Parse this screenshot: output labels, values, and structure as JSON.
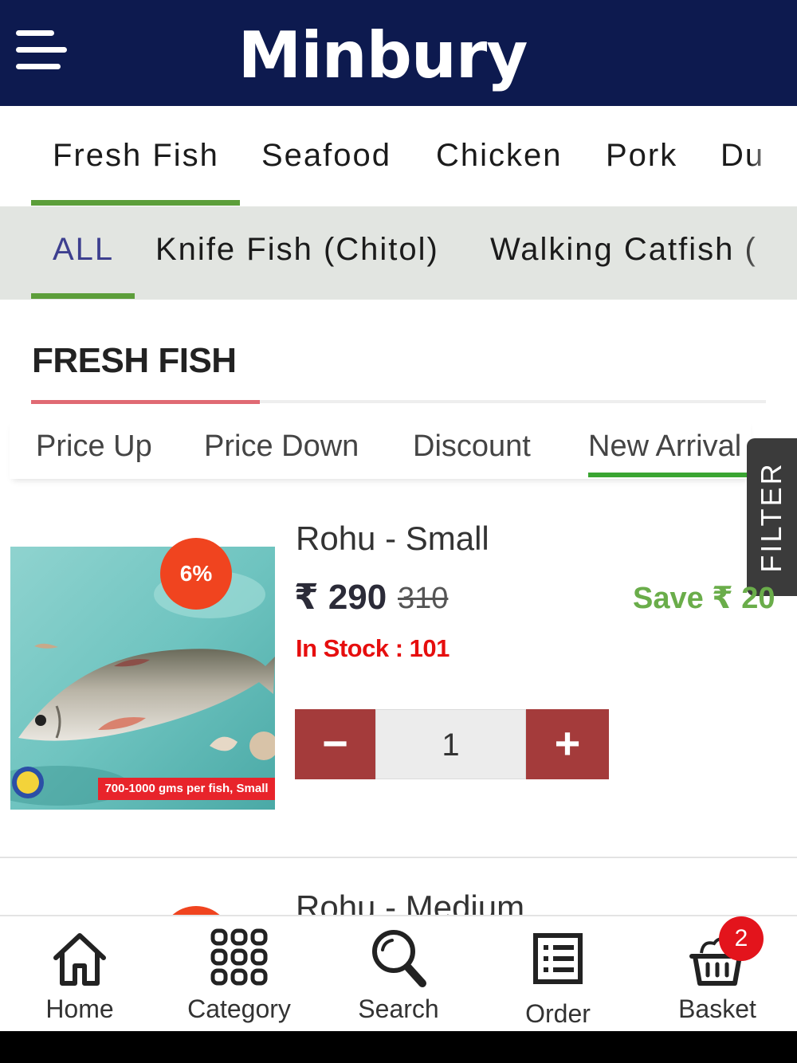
{
  "header": {
    "brand": "Minbury",
    "menu_icon": "hamburger-menu-icon"
  },
  "category_tabs": [
    "Fresh Fish",
    "Seafood",
    "Chicken",
    "Pork",
    "Du"
  ],
  "sub_tabs": [
    "ALL",
    "Knife Fish (Chitol)",
    "Walking Catfish ("
  ],
  "section": {
    "title": "FRESH FISH"
  },
  "sort_options": [
    "Price Up",
    "Price Down",
    "Discount",
    "New Arrival"
  ],
  "filter": {
    "label": "FILTER"
  },
  "products": [
    {
      "name": "Rohu - Small",
      "discount": "6%",
      "price": "₹ 290",
      "old_price": "310",
      "save": "Save ₹ 20",
      "stock": "In Stock : 101",
      "quantity": "1",
      "image_caption": "700-1000 gms per fish, Small"
    },
    {
      "name": "Rohu - Medium"
    }
  ],
  "stepper": {
    "minus": "−",
    "plus": "+"
  },
  "bottom_nav": [
    {
      "label": "Home",
      "icon": "home-icon"
    },
    {
      "label": "Category",
      "icon": "category-grid-icon"
    },
    {
      "label": "Search",
      "icon": "search-icon"
    },
    {
      "label": "Order",
      "icon": "order-list-icon"
    },
    {
      "label": "Basket",
      "icon": "basket-icon"
    }
  ],
  "basket_count": "2",
  "colors": {
    "header_bg": "#0d1a4f",
    "active_underline": "#5c9e3a",
    "badge_orange": "#f0441f",
    "stepper_red": "#a43b3b",
    "save_green": "#6aad4a",
    "stock_red": "#e60e0e"
  }
}
